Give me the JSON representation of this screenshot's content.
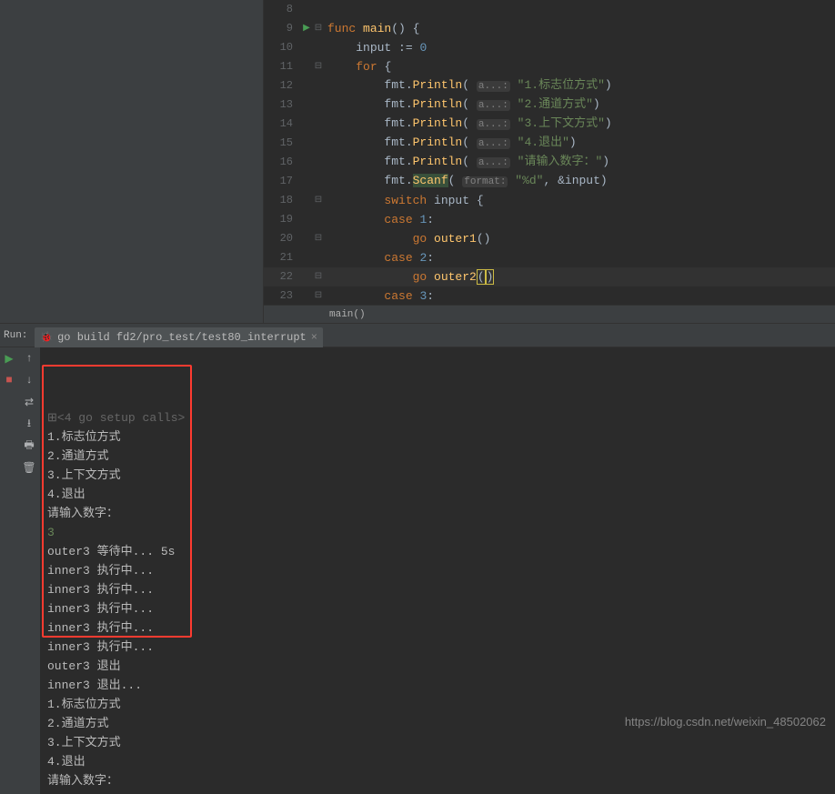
{
  "editor": {
    "lines": [
      {
        "n": 8,
        "run": false,
        "fold": "",
        "tokens": []
      },
      {
        "n": 9,
        "run": true,
        "fold": "⊟",
        "tokens": [
          [
            "kw",
            "func "
          ],
          [
            "fn",
            "main"
          ],
          [
            "op",
            "() {"
          ]
        ]
      },
      {
        "n": 10,
        "run": false,
        "fold": "",
        "tokens": [
          [
            "op",
            "    "
          ],
          [
            "pkg",
            "input"
          ],
          [
            "op",
            " := "
          ],
          [
            "num",
            "0"
          ]
        ]
      },
      {
        "n": 11,
        "run": false,
        "fold": "⊟",
        "tokens": [
          [
            "op",
            "    "
          ],
          [
            "kw",
            "for "
          ],
          [
            "op",
            "{"
          ]
        ]
      },
      {
        "n": 12,
        "run": false,
        "fold": "",
        "tokens": [
          [
            "op",
            "        fmt."
          ],
          [
            "fn",
            "Println"
          ],
          [
            "op",
            "( "
          ],
          [
            "param",
            "a...:"
          ],
          [
            "op",
            " "
          ],
          [
            "str",
            "\"1.标志位方式\""
          ],
          [
            "op",
            ")"
          ]
        ]
      },
      {
        "n": 13,
        "run": false,
        "fold": "",
        "tokens": [
          [
            "op",
            "        fmt."
          ],
          [
            "fn",
            "Println"
          ],
          [
            "op",
            "( "
          ],
          [
            "param",
            "a...:"
          ],
          [
            "op",
            " "
          ],
          [
            "str",
            "\"2.通道方式\""
          ],
          [
            "op",
            ")"
          ]
        ]
      },
      {
        "n": 14,
        "run": false,
        "fold": "",
        "tokens": [
          [
            "op",
            "        fmt."
          ],
          [
            "fn",
            "Println"
          ],
          [
            "op",
            "( "
          ],
          [
            "param",
            "a...:"
          ],
          [
            "op",
            " "
          ],
          [
            "str",
            "\"3.上下文方式\""
          ],
          [
            "op",
            ")"
          ]
        ]
      },
      {
        "n": 15,
        "run": false,
        "fold": "",
        "tokens": [
          [
            "op",
            "        fmt."
          ],
          [
            "fn",
            "Println"
          ],
          [
            "op",
            "( "
          ],
          [
            "param",
            "a...:"
          ],
          [
            "op",
            " "
          ],
          [
            "str",
            "\"4.退出\""
          ],
          [
            "op",
            ")"
          ]
        ]
      },
      {
        "n": 16,
        "run": false,
        "fold": "",
        "tokens": [
          [
            "op",
            "        fmt."
          ],
          [
            "fn",
            "Println"
          ],
          [
            "op",
            "( "
          ],
          [
            "param",
            "a...:"
          ],
          [
            "op",
            " "
          ],
          [
            "str",
            "\"请输入数字：\""
          ],
          [
            "op",
            ")"
          ]
        ]
      },
      {
        "n": 17,
        "run": false,
        "fold": "",
        "tokens": [
          [
            "op",
            "        fmt."
          ],
          [
            "hl-fn",
            "Scanf"
          ],
          [
            "op",
            "( "
          ],
          [
            "param",
            "format:"
          ],
          [
            "op",
            " "
          ],
          [
            "str",
            "\"%d\""
          ],
          [
            "op",
            ", &input)"
          ]
        ]
      },
      {
        "n": 18,
        "run": false,
        "fold": "⊟",
        "tokens": [
          [
            "op",
            "        "
          ],
          [
            "kw",
            "switch "
          ],
          [
            "pkg",
            "input"
          ],
          [
            "op",
            " {"
          ]
        ]
      },
      {
        "n": 19,
        "run": false,
        "fold": "",
        "tokens": [
          [
            "op",
            "        "
          ],
          [
            "kw",
            "case "
          ],
          [
            "num",
            "1"
          ],
          [
            "op",
            ":"
          ]
        ]
      },
      {
        "n": 20,
        "run": false,
        "fold": "⊟",
        "tokens": [
          [
            "op",
            "            "
          ],
          [
            "kw",
            "go "
          ],
          [
            "fn",
            "outer1"
          ],
          [
            "op",
            "()"
          ]
        ]
      },
      {
        "n": 21,
        "run": false,
        "fold": "",
        "tokens": [
          [
            "op",
            "        "
          ],
          [
            "kw",
            "case "
          ],
          [
            "num",
            "2"
          ],
          [
            "op",
            ":"
          ]
        ]
      },
      {
        "n": 22,
        "run": false,
        "fold": "⊟",
        "hl": true,
        "tokens": [
          [
            "op",
            "            "
          ],
          [
            "kw",
            "go "
          ],
          [
            "fn",
            "outer2"
          ],
          [
            "matchp",
            "("
          ],
          [
            "matchp",
            ")"
          ]
        ]
      },
      {
        "n": 23,
        "run": false,
        "fold": "⊟",
        "tokens": [
          [
            "op",
            "        "
          ],
          [
            "kw",
            "case "
          ],
          [
            "num",
            "3"
          ],
          [
            "op",
            ":"
          ]
        ]
      }
    ],
    "breadcrumb": "main()"
  },
  "run": {
    "label": "Run:",
    "tab": "go build fd2/pro_test/test80_interrupt",
    "setup": "<4 go setup calls>",
    "highlighted_output": [
      "1.标志位方式",
      "2.通道方式",
      "3.上下文方式",
      "4.退出",
      "请输入数字：",
      {
        "cls": "input-val",
        "text": "3"
      },
      "outer3 等待中... 5s",
      "inner3 执行中...",
      "inner3 执行中...",
      "inner3 执行中...",
      "inner3 执行中...",
      "inner3 执行中...",
      "outer3 退出",
      "inner3 退出..."
    ],
    "rest_output": [
      "1.标志位方式",
      "2.通道方式",
      "3.上下文方式",
      "4.退出",
      "请输入数字："
    ]
  },
  "watermark": "https://blog.csdn.net/weixin_48502062"
}
